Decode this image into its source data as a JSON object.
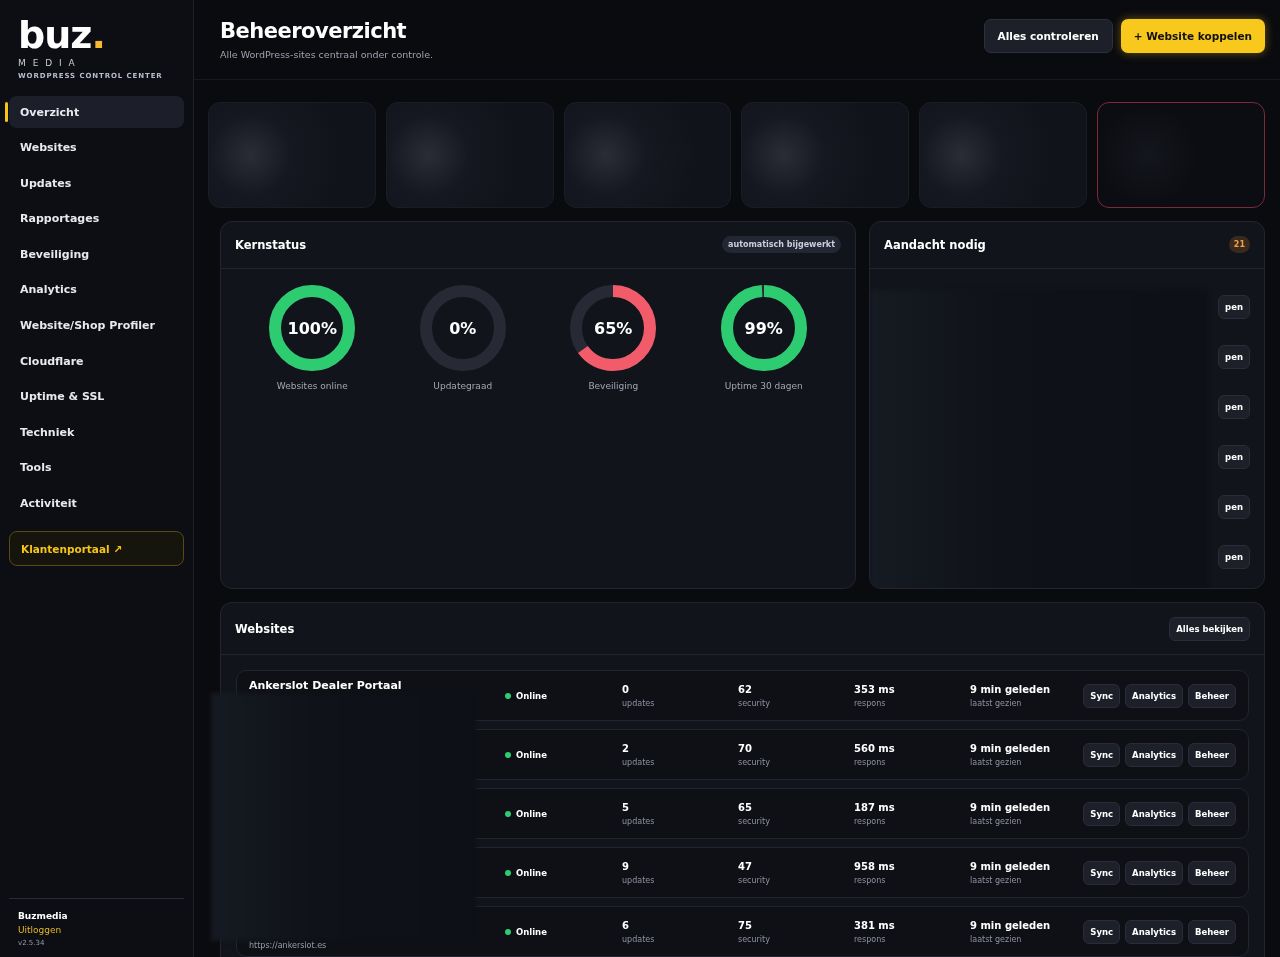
{
  "brand": {
    "logo": "buz",
    "logo_dot": ".",
    "sub": "M E D I A",
    "tagline": "WORDPRESS CONTROL CENTER"
  },
  "nav": [
    {
      "label": "Overzicht",
      "selected": true
    },
    {
      "label": "Websites",
      "selected": false
    },
    {
      "label": "Updates",
      "selected": false
    },
    {
      "label": "Rapportages",
      "selected": false
    },
    {
      "label": "Beveiliging",
      "selected": false
    },
    {
      "label": "Analytics",
      "selected": false
    },
    {
      "label": "Website/Shop Profiler",
      "selected": false
    },
    {
      "label": "Cloudflare",
      "selected": false
    },
    {
      "label": "Uptime & SSL",
      "selected": false
    },
    {
      "label": "Techniek",
      "selected": false
    },
    {
      "label": "Tools",
      "selected": false
    },
    {
      "label": "Activiteit",
      "selected": false
    }
  ],
  "portal_link": "Klantenportaal ↗",
  "user": {
    "name": "Buzmedia",
    "logout": "Uitloggen",
    "version": "v2.5.34"
  },
  "header": {
    "title": "Beheeroverzicht",
    "subtitle": "Alle WordPress-sites centraal onder controle.",
    "buttons": [
      {
        "label": "Alles controleren",
        "kind": "secondary"
      },
      {
        "label": "+ Website koppelen",
        "kind": "primary"
      }
    ]
  },
  "stat_cards": [
    {
      "alert": false
    },
    {
      "alert": false
    },
    {
      "alert": false
    },
    {
      "alert": false
    },
    {
      "alert": false
    },
    {
      "alert": true
    }
  ],
  "core_status": {
    "title": "Kernstatus",
    "badge": "automatisch bijgewerkt",
    "gauges": [
      {
        "value": "100%",
        "label": "Websites online",
        "level": 1,
        "color": "#2ecc71"
      },
      {
        "value": "0%",
        "label": "Updategraad",
        "level": 0
      },
      {
        "value": "65%",
        "label": "Beveiliging",
        "level": 0.65,
        "color": "#f25c6a"
      },
      {
        "value": "99%",
        "label": "Uptime 30 dagen",
        "level": 0.99,
        "color": "#2ecc71"
      }
    ]
  },
  "attention": {
    "title": "Aandacht nodig",
    "count": "21",
    "rows": [
      {
        "button": "pen"
      },
      {
        "button": "pen"
      },
      {
        "button": "pen"
      },
      {
        "button": "pen"
      },
      {
        "button": "pen"
      },
      {
        "button": "pen"
      }
    ]
  },
  "websites": {
    "title": "Websites",
    "view_all": "Alles bekijken",
    "rows": [
      {
        "name": "Ankerslot Dealer Portaal",
        "status": "Online",
        "online": true,
        "updates": "0",
        "updates_label": "updates",
        "security": "62",
        "security_label": "security",
        "response": "353 ms",
        "response_label": "respons",
        "seen": "9 min geleden",
        "seen_label": "laatst gezien",
        "actions": [
          "Sync",
          "Analytics",
          "Beheer"
        ]
      },
      {
        "status": "Online",
        "online": true,
        "updates": "2",
        "updates_label": "updates",
        "security": "70",
        "security_label": "security",
        "response": "560 ms",
        "response_label": "respons",
        "seen": "9 min geleden",
        "seen_label": "laatst gezien",
        "actions": [
          "Sync",
          "Analytics",
          "Beheer"
        ]
      },
      {
        "status": "Online",
        "online": true,
        "updates": "5",
        "updates_label": "updates",
        "security": "65",
        "security_label": "security",
        "response": "187 ms",
        "response_label": "respons",
        "seen": "9 min geleden",
        "seen_label": "laatst gezien",
        "actions": [
          "Sync",
          "Analytics",
          "Beheer"
        ]
      },
      {
        "status": "Online",
        "online": true,
        "updates": "9",
        "updates_label": "updates",
        "security": "47",
        "security_label": "security",
        "response": "958 ms",
        "response_label": "respons",
        "seen": "9 min geleden",
        "seen_label": "laatst gezien",
        "actions": [
          "Sync",
          "Analytics",
          "Beheer"
        ]
      },
      {
        "url": "https://ankerslot.es",
        "status": "Online",
        "online": true,
        "updates": "6",
        "updates_label": "updates",
        "security": "75",
        "security_label": "security",
        "response": "381 ms",
        "response_label": "respons",
        "seen": "9 min geleden",
        "seen_label": "laatst gezien",
        "actions": [
          "Sync",
          "Analytics",
          "Beheer"
        ]
      }
    ]
  }
}
